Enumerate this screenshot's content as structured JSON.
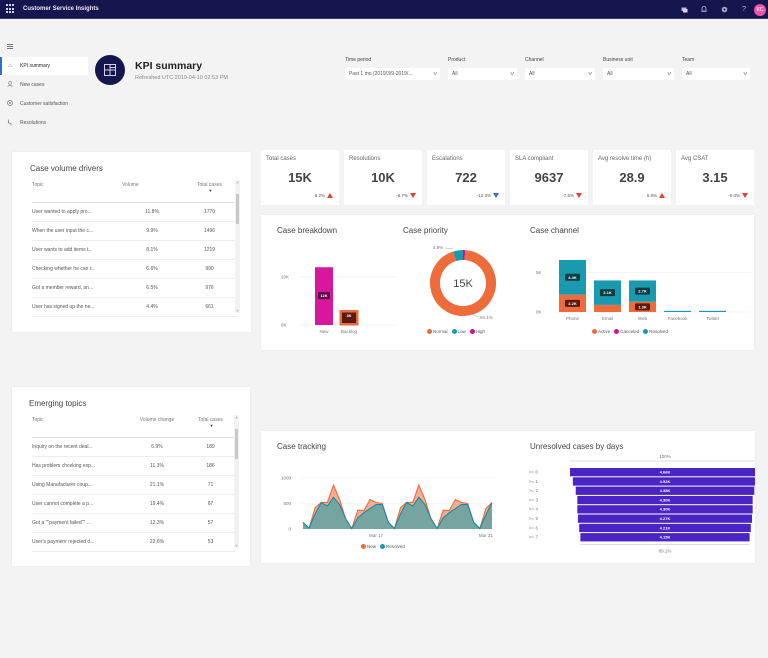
{
  "app": {
    "title": "Customer Service Insights",
    "header_icons": [
      "chat-icon",
      "bell-icon",
      "gear-icon",
      "help-icon"
    ],
    "help_glyph": "?",
    "avatar_initials": "KC",
    "avatar_color": "#e756a8",
    "header_color": "#16164f"
  },
  "sidebar": {
    "items": [
      {
        "label": "KPI summary",
        "icon": "home-icon",
        "active": true
      },
      {
        "label": "New cases",
        "icon": "person-icon",
        "active": false
      },
      {
        "label": "Customer satisfaction",
        "icon": "smiley-icon",
        "active": false
      },
      {
        "label": "Resolutions",
        "icon": "resolution-icon",
        "active": false
      }
    ]
  },
  "page": {
    "title": "KPI summary",
    "refreshed": "Refreshed UTC 2019-04-10 02:53 PM"
  },
  "filters": [
    {
      "label": "Time period",
      "value": "Past 1 mo (2019/3/9-2019/..."
    },
    {
      "label": "Product",
      "value": "All"
    },
    {
      "label": "Channel",
      "value": "All"
    },
    {
      "label": "Business unit",
      "value": "All"
    },
    {
      "label": "Team",
      "value": "All"
    }
  ],
  "kpis": [
    {
      "label": "Total cases",
      "value": "15K",
      "delta": "9.2%",
      "trend": "up",
      "color": "#e0452d"
    },
    {
      "label": "Resolutions",
      "value": "10K",
      "delta": "-6.7%",
      "trend": "down",
      "color": "#e0452d"
    },
    {
      "label": "Escalations",
      "value": "722",
      "delta": "-12.3%",
      "trend": "down",
      "color": "#2f6fd6"
    },
    {
      "label": "SLA compliant",
      "value": "9637",
      "delta": "-7.5%",
      "trend": "down",
      "color": "#e0452d"
    },
    {
      "label": "Avg resolve time (h)",
      "value": "28.9",
      "delta": "6.8%",
      "trend": "up",
      "color": "#e0452d"
    },
    {
      "label": "Avg CSAT",
      "value": "3.15",
      "delta": "-0.0%",
      "trend": "down",
      "color": "#e0452d"
    }
  ],
  "case_volume_drivers": {
    "title": "Case volume drivers",
    "columns": [
      "Topic",
      "Volume",
      "Total cases"
    ],
    "sort_indicator": "▼",
    "rows": [
      [
        "User wanted to apply pro...",
        "11.8%",
        "1770"
      ],
      [
        "When the user input the c...",
        "9.9%",
        "1496"
      ],
      [
        "User wants to add items t...",
        "8.1%",
        "1219"
      ],
      [
        "Checking whether he can r...",
        "6.6%",
        "990"
      ],
      [
        "Got a member reward, an...",
        "6.5%",
        "976"
      ],
      [
        "User has signed up the ne...",
        "4.4%",
        "661"
      ]
    ]
  },
  "emerging_topics": {
    "title": "Emerging topics",
    "columns": [
      "Topic",
      "Volume change",
      "Total cases"
    ],
    "sort_indicator": "▼",
    "rows": [
      [
        "Inquiry on the recent deal...",
        "6.9%",
        "189"
      ],
      [
        "Has problem chceking exp...",
        "11.3%",
        "186"
      ],
      [
        "Using Manufacturer coup...",
        "21.1%",
        "71"
      ],
      [
        "User cannot complete a p...",
        "19.4%",
        "67"
      ],
      [
        "Got a \"\"payment failed\"\" ...",
        "12.3%",
        "57"
      ],
      [
        "User's paymenr rejected d...",
        "22.6%",
        "53"
      ]
    ]
  },
  "scroll": {
    "up": "˄",
    "down": "˅"
  },
  "chart_data": [
    {
      "id": "case-breakdown",
      "type": "bar",
      "title": "Case breakdown",
      "categories": [
        "New",
        "Backlog"
      ],
      "values": [
        12000,
        3000
      ],
      "data_labels": [
        "12K",
        "3K"
      ],
      "colors": [
        "#d7179e",
        "#e96a3e"
      ],
      "yticks": [
        "10K",
        "0K"
      ],
      "ytick_values": [
        10000,
        0
      ],
      "ylim": [
        0,
        13500
      ],
      "grid": true
    },
    {
      "id": "case-priority",
      "type": "pie",
      "title": "Case priority",
      "center_label": "15K",
      "labels": [
        "Normal",
        "Low",
        "High"
      ],
      "values": [
        94.1,
        4.8,
        1.1
      ],
      "slice_labels": [
        "94.1%",
        "4.8%",
        ""
      ],
      "colors": [
        "#ee6b3b",
        "#1a9aae",
        "#c4168f"
      ],
      "legend": "bottom"
    },
    {
      "id": "case-channel",
      "type": "bar",
      "stacked": true,
      "title": "Case channel",
      "categories": [
        "Phone",
        "Email",
        "Web",
        "Facebook",
        "Twitter"
      ],
      "series": [
        {
          "name": "Active",
          "color": "#ee6b3b",
          "values": [
            2200,
            900,
            1300,
            0,
            0
          ],
          "labels": [
            "2.2K",
            "",
            "1.3K",
            "",
            ""
          ]
        },
        {
          "name": "Canceled",
          "color": "#c4168f",
          "values": [
            0,
            0,
            0,
            0,
            0
          ],
          "labels": [
            "",
            "",
            "",
            "",
            ""
          ]
        },
        {
          "name": "Resolved",
          "color": "#1a9aae",
          "values": [
            4400,
            3100,
            2700,
            150,
            150
          ],
          "labels": [
            "4.4K",
            "3.1K",
            "2.7K",
            "",
            ""
          ]
        }
      ],
      "yticks": [
        "5K",
        "0K"
      ],
      "ytick_values": [
        5000,
        0
      ],
      "ylim": [
        0,
        7000
      ],
      "grid": true,
      "legend": "bottom"
    },
    {
      "id": "case-tracking",
      "type": "area",
      "title": "Case tracking",
      "x_ticks": [
        "Mar 17",
        "Mar 31"
      ],
      "x_tick_index": [
        12,
        30
      ],
      "yticks": [
        "1000",
        "500",
        "0"
      ],
      "ytick_values": [
        1000,
        500,
        0
      ],
      "ylim": [
        0,
        1000
      ],
      "series": [
        {
          "name": "New",
          "color": "#ee6b3b",
          "values": [
            130,
            20,
            420,
            520,
            520,
            860,
            580,
            200,
            10,
            370,
            360,
            580,
            520,
            500,
            130,
            10,
            420,
            520,
            520,
            860,
            580,
            200,
            10,
            370,
            360,
            580,
            520,
            500,
            130,
            10,
            400,
            520
          ]
        },
        {
          "name": "Resolved",
          "color": "#1a9aae",
          "values": [
            130,
            20,
            300,
            520,
            450,
            620,
            480,
            200,
            10,
            220,
            320,
            400,
            480,
            480,
            130,
            10,
            300,
            520,
            450,
            620,
            480,
            200,
            10,
            220,
            320,
            400,
            480,
            480,
            130,
            10,
            280,
            520
          ]
        }
      ],
      "legend": "bottom"
    },
    {
      "id": "unresolved-by-days",
      "type": "bar",
      "orientation": "funnel",
      "title": "Unresolved cases by days",
      "categories": [
        ">= 0",
        ">= 1",
        ">= 2",
        ">= 3",
        ">= 4",
        ">= 5",
        ">= 6",
        ">= 7"
      ],
      "values": [
        4660,
        4520,
        4380,
        4300,
        4300,
        4270,
        4210,
        4150
      ],
      "data_labels": [
        "4.66K",
        "4.52K",
        "4.38K",
        "4.30K",
        "4.30K",
        "4.27K",
        "4.21K",
        "4.15K"
      ],
      "top_percent": "100%",
      "bottom_percent": "89.1%",
      "color": "#4b24c4"
    }
  ]
}
